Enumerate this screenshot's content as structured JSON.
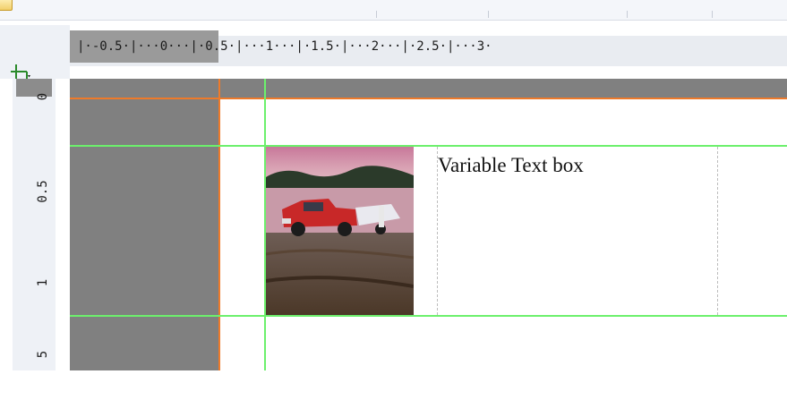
{
  "ruler": {
    "horizontal_text": "|·-0.5·|···0···|·0.5·|···1···|·1.5·|···2···|·2.5·|···3·",
    "vertical_labels": [
      "0",
      "0.5",
      "1",
      "5"
    ]
  },
  "canvas": {
    "text_box": {
      "value": "Variable Text box"
    }
  },
  "colors": {
    "margin_gray": "#808080",
    "orange_guide": "#ee7a2a",
    "green_guide": "#6cf06c"
  },
  "icons": {
    "corner": "crop-anchor-icon",
    "document": "document-icon"
  }
}
